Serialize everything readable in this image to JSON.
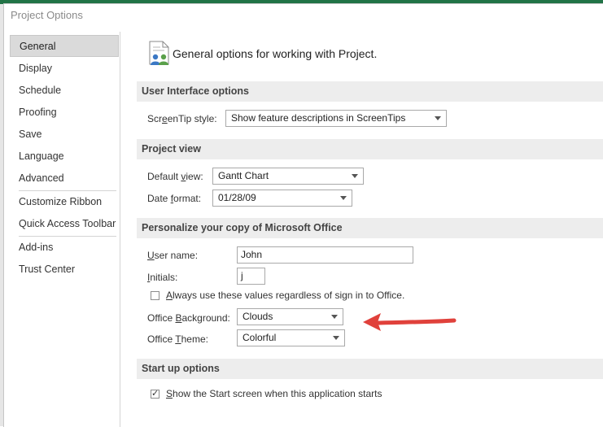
{
  "dialog": {
    "title": "Project Options"
  },
  "nav": {
    "items": [
      {
        "label": "General",
        "selected": true
      },
      {
        "label": "Display"
      },
      {
        "label": "Schedule"
      },
      {
        "label": "Proofing"
      },
      {
        "label": "Save"
      },
      {
        "label": "Language"
      },
      {
        "label": "Advanced"
      },
      {
        "label": "Customize Ribbon"
      },
      {
        "label": "Quick Access Toolbar"
      },
      {
        "label": "Add-ins"
      },
      {
        "label": "Trust Center"
      }
    ]
  },
  "header": {
    "text": "General options for working with Project.",
    "icon": "general-options-icon"
  },
  "sections": {
    "ui": {
      "title": "User Interface options"
    },
    "view": {
      "title": "Project view"
    },
    "personalize": {
      "title": "Personalize your copy of Microsoft Office"
    },
    "startup": {
      "title": "Start up options"
    }
  },
  "fields": {
    "screentip": {
      "label_pre": "Scr",
      "label_u": "e",
      "label_post": "enTip style:",
      "value": "Show feature descriptions in ScreenTips"
    },
    "default_view": {
      "label_pre": "Default ",
      "label_u": "v",
      "label_post": "iew:",
      "value": "Gantt Chart"
    },
    "date_format": {
      "label_pre": "Date ",
      "label_u": "f",
      "label_post": "ormat:",
      "value": "01/28/09"
    },
    "user_name": {
      "label_pre": "",
      "label_u": "U",
      "label_post": "ser name:",
      "value": "John"
    },
    "initials": {
      "label_pre": "",
      "label_u": "I",
      "label_post": "nitials:",
      "value": "j"
    },
    "always_use": {
      "label_pre": "",
      "label_u": "A",
      "label_post": "lways use these values regardless of sign in to Office.",
      "checked": false
    },
    "office_bg": {
      "label_pre": "Office ",
      "label_u": "B",
      "label_post": "ackground:",
      "value": "Clouds"
    },
    "office_theme": {
      "label_pre": "Office ",
      "label_u": "T",
      "label_post": "heme:",
      "value": "Colorful"
    },
    "show_start": {
      "label_pre": "",
      "label_u": "S",
      "label_post": "how the Start screen when this application starts",
      "checked": true
    }
  },
  "colors": {
    "annotation_arrow": "#e0413b",
    "app_accent": "#217346"
  }
}
